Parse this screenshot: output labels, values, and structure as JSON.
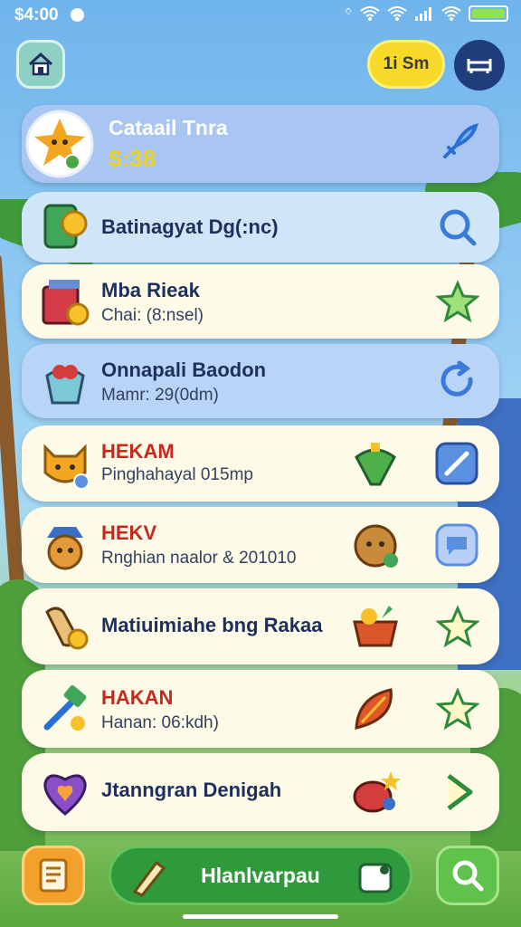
{
  "status": {
    "time": "$4:00"
  },
  "top": {
    "coins_label": "1i Sm"
  },
  "header_card": {
    "title": "Cataail Tnra",
    "value": "$:38",
    "value_color": "#f0d21a"
  },
  "cards": [
    {
      "title": "Batinagyat Dg(:nc)",
      "subtitle": ""
    },
    {
      "title": "Mba Rieak",
      "subtitle": "Chai: (8:nsel)"
    },
    {
      "title": "Onnapali Baodon",
      "subtitle": "Mamr: 29(0dm)"
    },
    {
      "title": "HEKAM",
      "subtitle": "Pinghahayal 015mp"
    },
    {
      "title": "HEKV",
      "subtitle": "Rnghian naalor & 201010"
    },
    {
      "title": "Matiuimiahe bng Rakaa",
      "subtitle": ""
    },
    {
      "title": "HAKAN",
      "subtitle": "Hanan: 06:kdh)"
    },
    {
      "title": "Jtanngran Denigah",
      "subtitle": ""
    }
  ],
  "bottom": {
    "action_label": "Hlanlvarpau"
  },
  "icons": {
    "home": "home-icon",
    "menu": "sofa-icon",
    "notes": "notes-icon",
    "search": "search-icon",
    "pen": "pen-icon",
    "photo": "photo-icon"
  },
  "colors": {
    "accent_red": "#c7281c",
    "title_navy": "#1f2f5c",
    "green": "#2f9a3b",
    "gold": "#f7d92a"
  }
}
